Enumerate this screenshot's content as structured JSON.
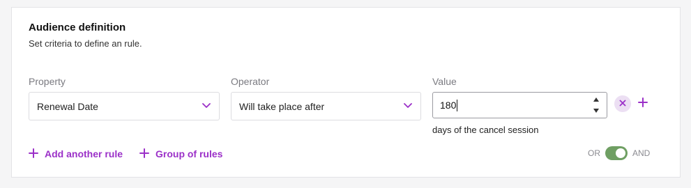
{
  "section": {
    "title": "Audience definition",
    "subtitle": "Set criteria to define an rule."
  },
  "rule": {
    "property": {
      "label": "Property",
      "value": "Renewal Date",
      "icon": "chevron-down-icon"
    },
    "operator": {
      "label": "Operator",
      "value": "Will take place after",
      "icon": "chevron-down-icon"
    },
    "value": {
      "label": "Value",
      "input_value": "180",
      "hint": "days of the cancel session"
    },
    "remove_icon": "close-icon",
    "add_icon": "plus-icon"
  },
  "actions": {
    "add_rule_label": "Add another rule",
    "group_rules_label": "Group of rules"
  },
  "logic_toggle": {
    "left_label": "OR",
    "right_label": "AND",
    "selected": "AND"
  },
  "colors": {
    "accent": "#9b30c8",
    "toggle_on": "#6f9f63",
    "remove_bg": "#ecdff3"
  }
}
